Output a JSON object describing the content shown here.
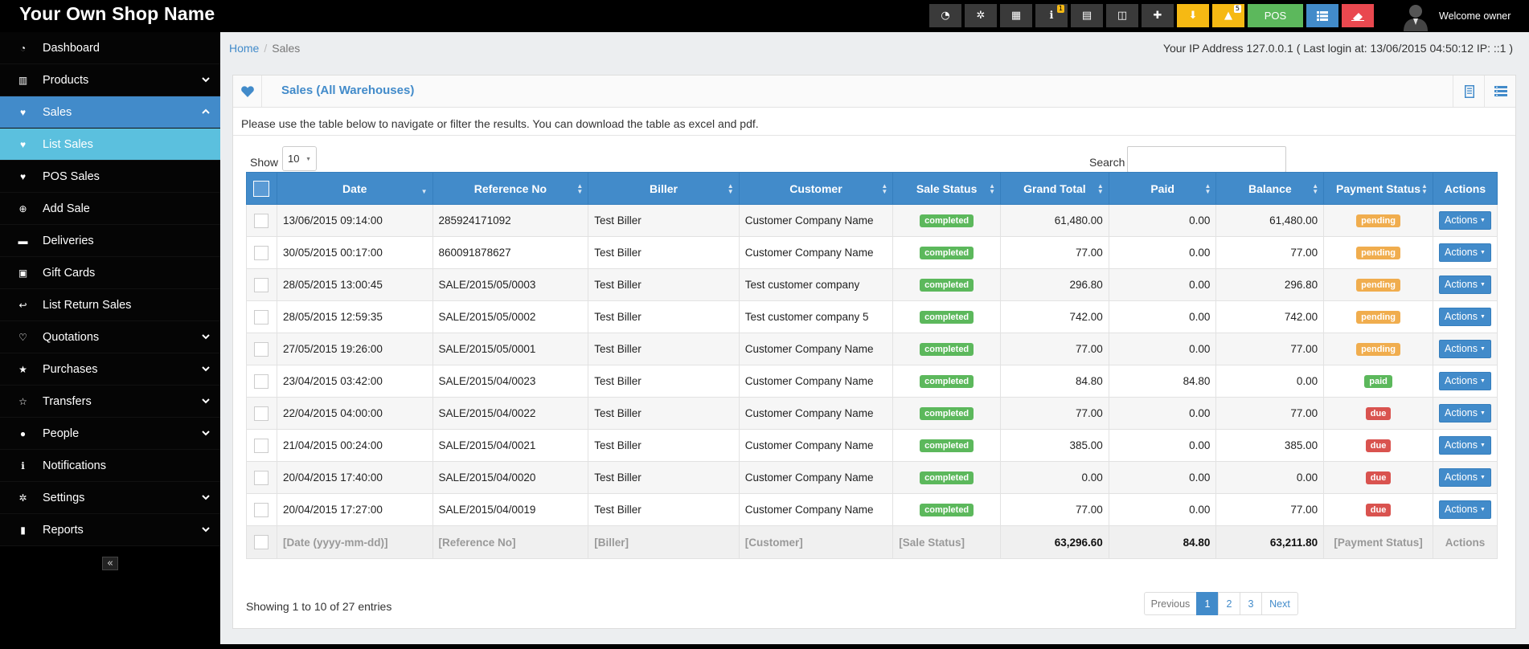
{
  "app": {
    "brand": "Your Own Shop Name"
  },
  "topbar": {
    "icons": [
      {
        "name": "dashboard-icon",
        "style": "dark",
        "glyph": "◔"
      },
      {
        "name": "settings-cogs-icon",
        "style": "dark",
        "glyph": "✲"
      },
      {
        "name": "calculator-icon",
        "style": "dark",
        "glyph": "▦"
      },
      {
        "name": "info-icon",
        "style": "dark",
        "glyph": "ℹ",
        "count": "1"
      },
      {
        "name": "calendar-icon",
        "style": "dark",
        "glyph": "▤"
      },
      {
        "name": "styles-icon",
        "style": "dark",
        "glyph": "◫"
      },
      {
        "name": "language-flag-icon",
        "style": "dark",
        "glyph": "✚"
      },
      {
        "name": "download-icon",
        "style": "yellow",
        "glyph": "⬇"
      },
      {
        "name": "alert-icon",
        "style": "yellow",
        "glyph": "▲",
        "count": "5"
      }
    ],
    "pos_label": "POS",
    "list_icon": "list-icon",
    "eraser_icon": "eraser-icon",
    "welcome": "Welcome owner"
  },
  "sidebar": {
    "items": [
      {
        "label": "Dashboard",
        "icon": "dashboard-icon",
        "glyph": "◔",
        "state": "",
        "chevron": ""
      },
      {
        "label": "Products",
        "icon": "barcode-icon",
        "glyph": "▥",
        "state": "",
        "chevron": "down"
      },
      {
        "label": "Sales",
        "icon": "heart-icon",
        "glyph": "♥",
        "state": "active",
        "chevron": "up"
      },
      {
        "label": "List Sales",
        "icon": "heart-icon",
        "glyph": "♥",
        "state": "sub-active",
        "chevron": ""
      },
      {
        "label": "POS Sales",
        "icon": "heart-icon",
        "glyph": "♥",
        "state": "",
        "chevron": ""
      },
      {
        "label": "Add Sale",
        "icon": "plus-circle-icon",
        "glyph": "⊕",
        "state": "",
        "chevron": ""
      },
      {
        "label": "Deliveries",
        "icon": "truck-icon",
        "glyph": "▬",
        "state": "",
        "chevron": ""
      },
      {
        "label": "Gift Cards",
        "icon": "gift-icon",
        "glyph": "▣",
        "state": "",
        "chevron": ""
      },
      {
        "label": "List Return Sales",
        "icon": "reply-icon",
        "glyph": "↩",
        "state": "",
        "chevron": ""
      },
      {
        "label": "Quotations",
        "icon": "heart-outline-icon",
        "glyph": "♡",
        "state": "",
        "chevron": "down"
      },
      {
        "label": "Purchases",
        "icon": "star-icon",
        "glyph": "★",
        "state": "",
        "chevron": "down"
      },
      {
        "label": "Transfers",
        "icon": "star-outline-icon",
        "glyph": "☆",
        "state": "",
        "chevron": "down"
      },
      {
        "label": "People",
        "icon": "users-icon",
        "glyph": "●",
        "state": "",
        "chevron": "down"
      },
      {
        "label": "Notifications",
        "icon": "info-circle-icon",
        "glyph": "ℹ",
        "state": "",
        "chevron": ""
      },
      {
        "label": "Settings",
        "icon": "cog-icon",
        "glyph": "✲",
        "state": "",
        "chevron": "down"
      },
      {
        "label": "Reports",
        "icon": "bar-chart-icon",
        "glyph": "▮",
        "state": "",
        "chevron": "down"
      }
    ],
    "collapse_glyph": "«"
  },
  "breadcrumb": {
    "home": "Home",
    "sep": "/",
    "current": "Sales"
  },
  "ip_info": "Your IP Address 127.0.0.1 ( Last login at: 13/06/2015 04:50:12 IP: ::1 )",
  "box": {
    "title": "Sales (All Warehouses)",
    "intro": "Please use the table below to navigate or filter the results. You can download the table as excel and pdf."
  },
  "controls": {
    "show_label": "Show",
    "show_value": "10",
    "search_label": "Search",
    "search_value": ""
  },
  "table": {
    "columns": [
      "Date",
      "Reference No",
      "Biller",
      "Customer",
      "Sale Status",
      "Grand Total",
      "Paid",
      "Balance",
      "Payment Status",
      "Actions"
    ],
    "rows": [
      {
        "date": "13/06/2015 09:14:00",
        "ref": "285924171092",
        "biller": "Test Biller",
        "customer": "Customer Company Name",
        "sale_status": "completed",
        "grand_total": "61,480.00",
        "paid": "0.00",
        "balance": "61,480.00",
        "payment_status": "pending",
        "action": "Actions"
      },
      {
        "date": "30/05/2015 00:17:00",
        "ref": "860091878627",
        "biller": "Test Biller",
        "customer": "Customer Company Name",
        "sale_status": "completed",
        "grand_total": "77.00",
        "paid": "0.00",
        "balance": "77.00",
        "payment_status": "pending",
        "action": "Actions"
      },
      {
        "date": "28/05/2015 13:00:45",
        "ref": "SALE/2015/05/0003",
        "biller": "Test Biller",
        "customer": "Test customer company",
        "sale_status": "completed",
        "grand_total": "296.80",
        "paid": "0.00",
        "balance": "296.80",
        "payment_status": "pending",
        "action": "Actions"
      },
      {
        "date": "28/05/2015 12:59:35",
        "ref": "SALE/2015/05/0002",
        "biller": "Test Biller",
        "customer": "Test customer company 5",
        "sale_status": "completed",
        "grand_total": "742.00",
        "paid": "0.00",
        "balance": "742.00",
        "payment_status": "pending",
        "action": "Actions"
      },
      {
        "date": "27/05/2015 19:26:00",
        "ref": "SALE/2015/05/0001",
        "biller": "Test Biller",
        "customer": "Customer Company Name",
        "sale_status": "completed",
        "grand_total": "77.00",
        "paid": "0.00",
        "balance": "77.00",
        "payment_status": "pending",
        "action": "Actions"
      },
      {
        "date": "23/04/2015 03:42:00",
        "ref": "SALE/2015/04/0023",
        "biller": "Test Biller",
        "customer": "Customer Company Name",
        "sale_status": "completed",
        "grand_total": "84.80",
        "paid": "84.80",
        "balance": "0.00",
        "payment_status": "paid",
        "action": "Actions"
      },
      {
        "date": "22/04/2015 04:00:00",
        "ref": "SALE/2015/04/0022",
        "biller": "Test Biller",
        "customer": "Customer Company Name",
        "sale_status": "completed",
        "grand_total": "77.00",
        "paid": "0.00",
        "balance": "77.00",
        "payment_status": "due",
        "action": "Actions"
      },
      {
        "date": "21/04/2015 00:24:00",
        "ref": "SALE/2015/04/0021",
        "biller": "Test Biller",
        "customer": "Customer Company Name",
        "sale_status": "completed",
        "grand_total": "385.00",
        "paid": "0.00",
        "balance": "385.00",
        "payment_status": "due",
        "action": "Actions"
      },
      {
        "date": "20/04/2015 17:40:00",
        "ref": "SALE/2015/04/0020",
        "biller": "Test Biller",
        "customer": "Customer Company Name",
        "sale_status": "completed",
        "grand_total": "0.00",
        "paid": "0.00",
        "balance": "0.00",
        "payment_status": "due",
        "action": "Actions"
      },
      {
        "date": "20/04/2015 17:27:00",
        "ref": "SALE/2015/04/0019",
        "biller": "Test Biller",
        "customer": "Customer Company Name",
        "sale_status": "completed",
        "grand_total": "77.00",
        "paid": "0.00",
        "balance": "77.00",
        "payment_status": "due",
        "action": "Actions"
      }
    ],
    "footer": {
      "date": "[Date (yyyy-mm-dd)]",
      "ref": "[Reference No]",
      "biller": "[Biller]",
      "customer": "[Customer]",
      "sale_status": "[Sale Status]",
      "grand_total": "63,296.60",
      "paid": "84.80",
      "balance": "63,211.80",
      "payment_status": "[Payment Status]",
      "action": "Actions"
    }
  },
  "showing": "Showing 1 to 10 of 27 entries",
  "pagination": {
    "previous": "Previous",
    "pages": [
      "1",
      "2",
      "3"
    ],
    "current": "1",
    "next": "Next"
  },
  "colors": {
    "primary": "#428bca",
    "sub_active": "#5bc0de",
    "completed": "#5cb85c",
    "pending": "#f0ad4e",
    "due": "#d9534f"
  }
}
